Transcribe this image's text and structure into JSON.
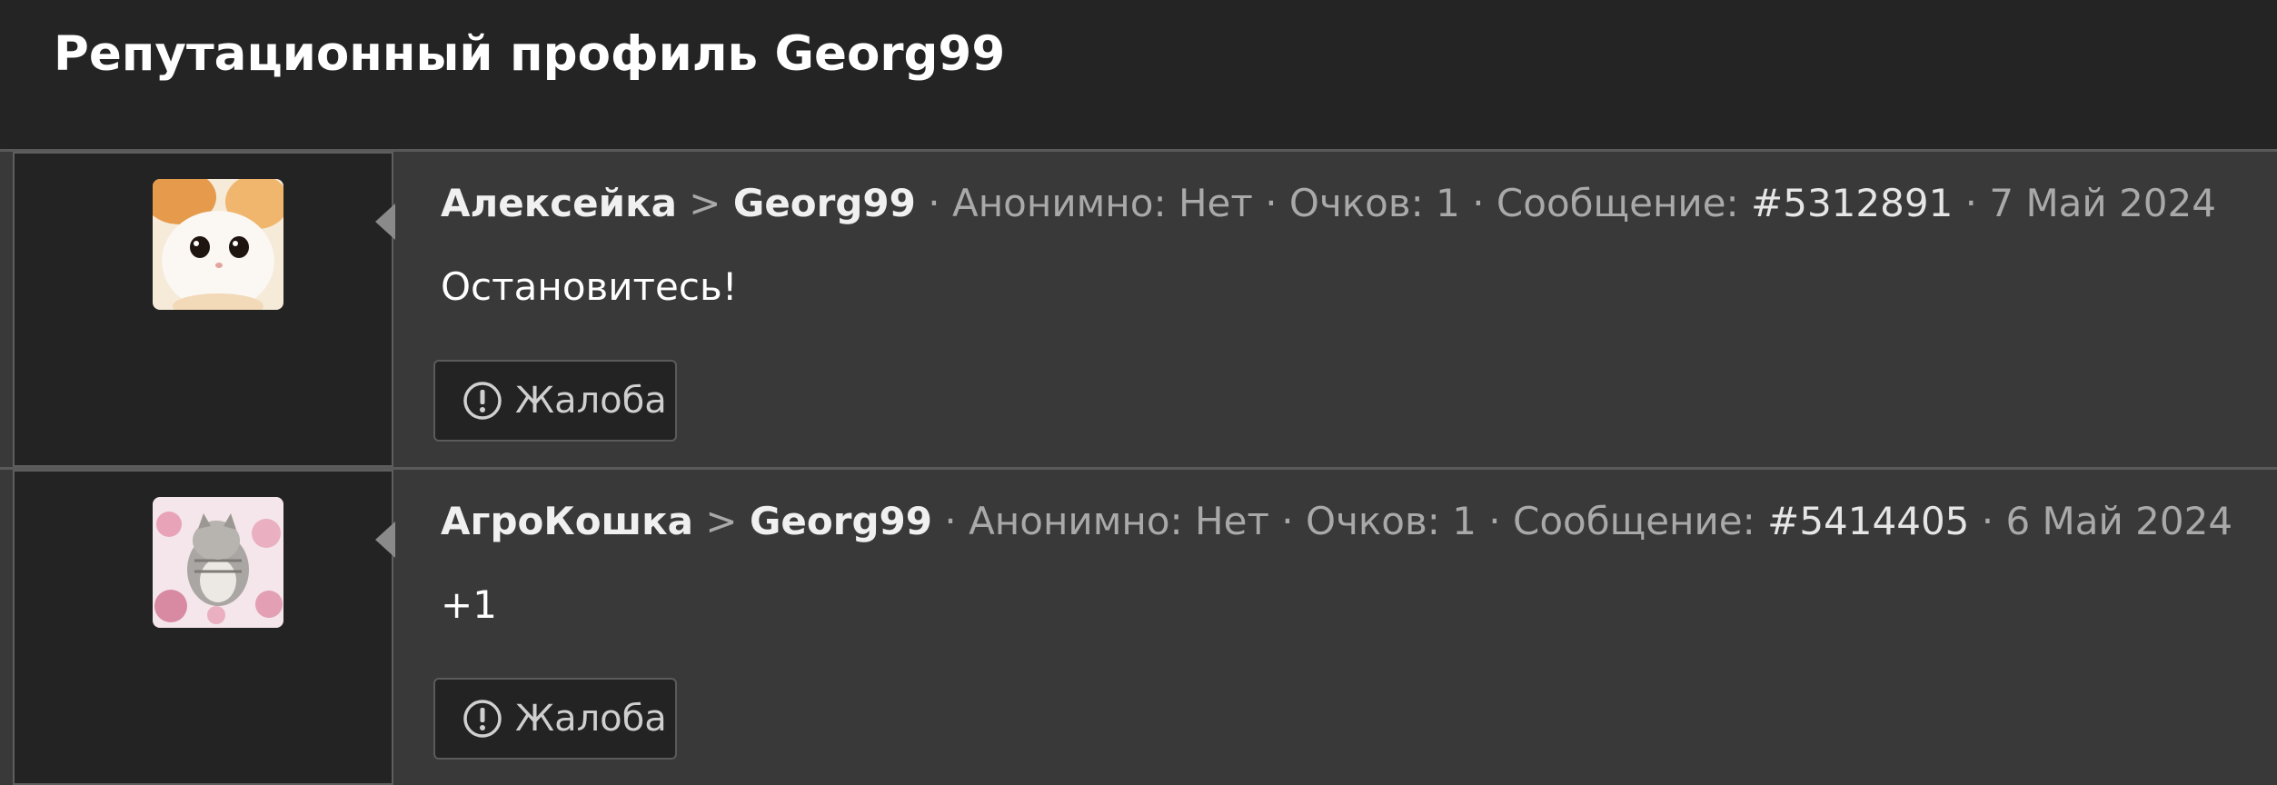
{
  "page": {
    "title": "Репутационный профиль Georg99"
  },
  "separators": {
    "arrow": ">",
    "dot": "·"
  },
  "entries": [
    {
      "author": "Алексейка",
      "target": "Georg99",
      "anonymous_label": "Анонимно: Нет",
      "points_label": "Очков: 1",
      "message_label": "Сообщение:",
      "message_id": "#5312891",
      "date": "7 Май 2024",
      "comment": "Остановитесь!",
      "report_label": "Жалоба",
      "avatar_icon": "kitten-avatar-icon"
    },
    {
      "author": "АгроКошка",
      "target": "Georg99",
      "anonymous_label": "Анонимно: Нет",
      "points_label": "Очков: 1",
      "message_label": "Сообщение:",
      "message_id": "#5414405",
      "date": "6 Май 2024",
      "comment": "+1",
      "report_label": "Жалоба",
      "avatar_icon": "cat-flowers-avatar-icon"
    }
  ],
  "colors": {
    "header_bg": "#242424",
    "entry_bg": "#393939",
    "panel_bg": "#232323",
    "name_text": "#f0f0f0",
    "meta_text": "#a9a9a9"
  }
}
